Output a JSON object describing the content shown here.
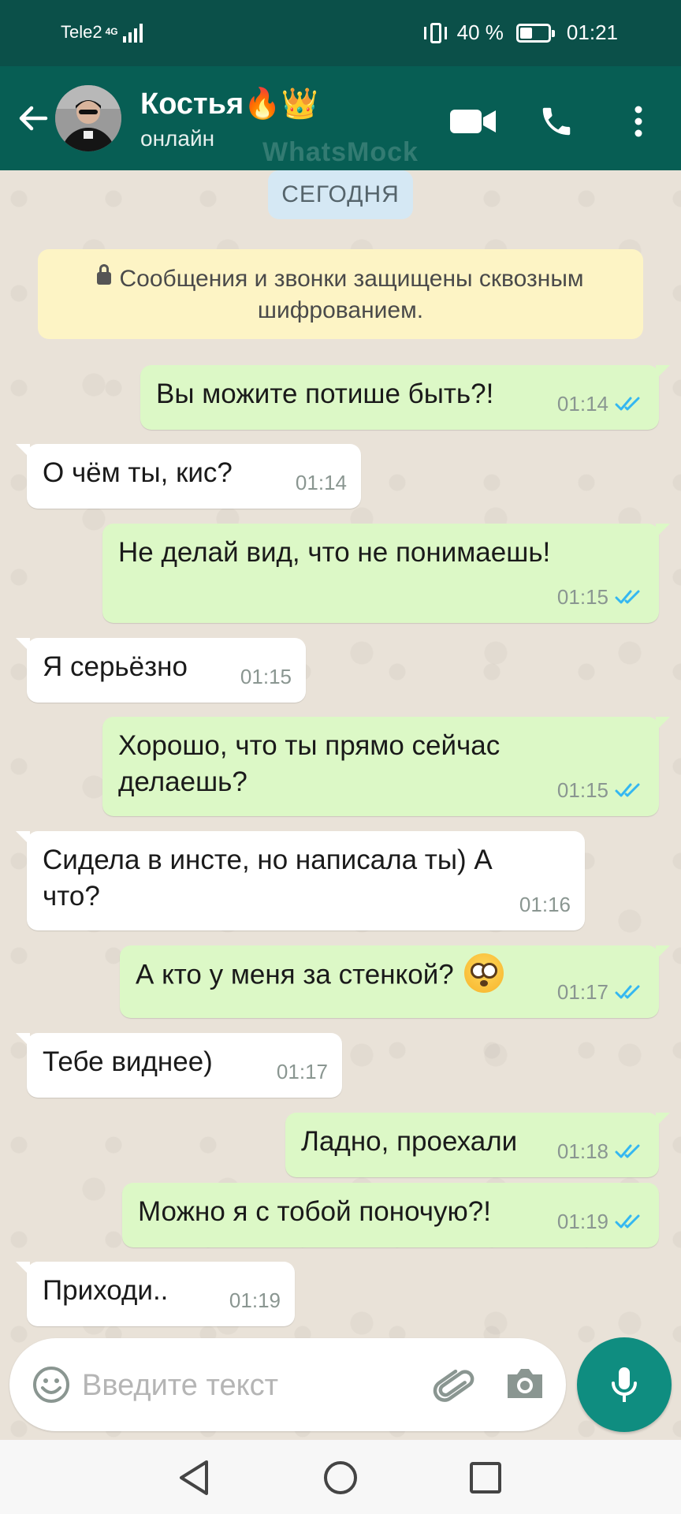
{
  "status_bar": {
    "carrier": "Tele2",
    "network": "4G",
    "battery_percent": "40 %",
    "battery_level": 0.4,
    "time": "01:21"
  },
  "header": {
    "contact_name": "Костья🔥👑",
    "contact_status": "онлайн",
    "watermark": "WhatsMock",
    "icons": [
      "back-arrow-icon",
      "video-call-icon",
      "phone-icon",
      "more-vert-icon"
    ]
  },
  "chat": {
    "date_label": "СЕГОДНЯ",
    "encryption_notice": "Сообщения и звонки защищены сквозным шифрованием.",
    "messages": [
      {
        "dir": "out",
        "lines": [
          "Вы можите потише быть?!"
        ],
        "time": "01:14",
        "status": "read"
      },
      {
        "dir": "in",
        "lines": [
          "О чём ты, кис?"
        ],
        "time": "01:14"
      },
      {
        "dir": "out",
        "lines": [
          "Не делай вид, что не понимаешь!"
        ],
        "time": "01:15",
        "status": "read"
      },
      {
        "dir": "in",
        "lines": [
          "Я серьёзно"
        ],
        "time": "01:15"
      },
      {
        "dir": "out",
        "lines": [
          "Хорошо, что ты прямо сейчас",
          "делаешь?"
        ],
        "time": "01:15",
        "status": "read"
      },
      {
        "dir": "in",
        "lines": [
          "Сидела в инсте, но написала ты) А",
          "что?"
        ],
        "time": "01:16"
      },
      {
        "dir": "out",
        "lines": [
          "А кто у меня за стенкой?"
        ],
        "emoji": "flushed-face-emoji",
        "time": "01:17",
        "status": "read"
      },
      {
        "dir": "in",
        "lines": [
          "Тебе виднее)"
        ],
        "time": "01:17"
      },
      {
        "dir": "out",
        "lines": [
          "Ладно, проехали"
        ],
        "time": "01:18",
        "status": "read"
      },
      {
        "dir": "out",
        "lines": [
          "Можно я с тобой поночую?!"
        ],
        "time": "01:19",
        "status": "read"
      },
      {
        "dir": "in",
        "lines": [
          "Приходи.."
        ],
        "time": "01:19"
      }
    ]
  },
  "composer": {
    "placeholder": "Введите текст",
    "icons": [
      "emoji-icon",
      "attach-icon",
      "camera-icon",
      "mic-icon"
    ]
  },
  "colors": {
    "header_bg": "#075e54",
    "outgoing_bubble": "#dcf8c6",
    "incoming_bubble": "#ffffff",
    "read_ticks": "#34b7f1",
    "mic_button": "#0f8d80"
  }
}
